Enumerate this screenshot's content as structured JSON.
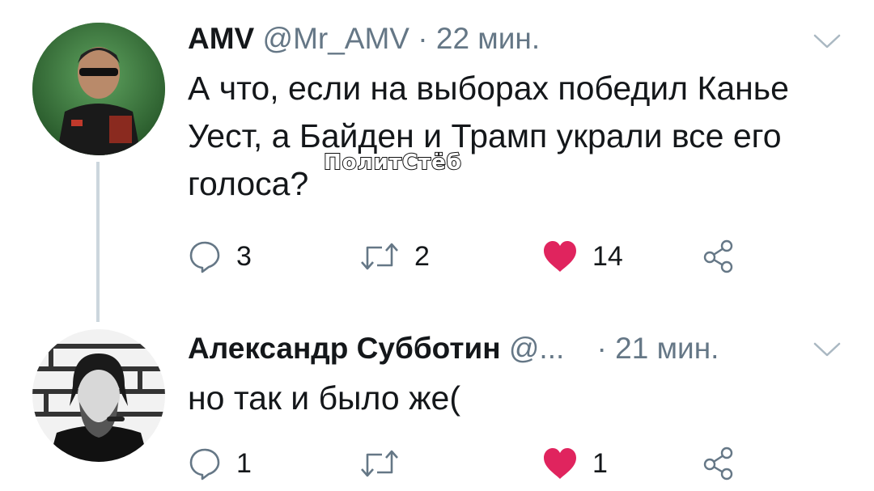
{
  "tweets": [
    {
      "author_name": "AMV",
      "handle": "@Mr_AMV",
      "separator": "·",
      "time": "22 мин.",
      "text_lines": [
        "А что, если на выборах победил Канье",
        "Уест, а Байден и Трамп украли все его",
        "голоса?"
      ],
      "replies": "3",
      "retweets": "2",
      "likes": "14",
      "liked": true,
      "menu_icon": "chevron-down-icon"
    },
    {
      "author_name": "Александр Субботин",
      "handle": "@...",
      "separator": "·",
      "time": "21 мин.",
      "text_lines": [
        "но так и было же("
      ],
      "replies": "1",
      "retweets": "",
      "likes": "1",
      "liked": true,
      "menu_icon": "chevron-down-icon"
    }
  ],
  "watermark": "ПолитСтёб",
  "colors": {
    "text": "#14171a",
    "secondary_text": "#657786",
    "icon_gray": "#657786",
    "like_red": "#e0245e",
    "thread_line": "#ccd6dd",
    "background": "#ffffff"
  },
  "icons": {
    "reply": "speech-bubble-icon",
    "retweet": "retweet-arrows-icon",
    "like": "heart-icon",
    "share": "share-nodes-icon"
  }
}
